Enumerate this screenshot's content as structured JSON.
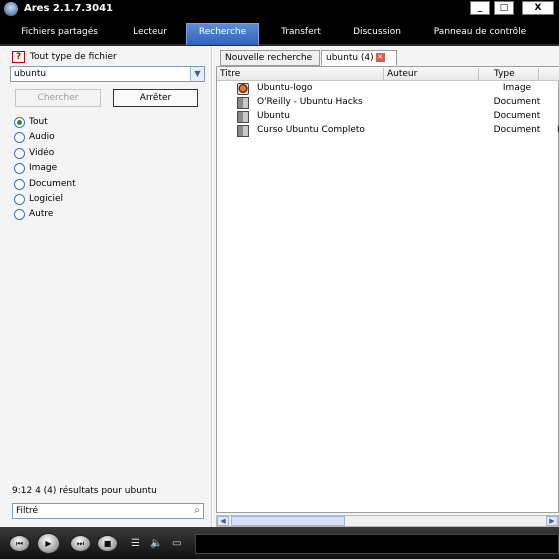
{
  "window": {
    "title": "Ares 2.1.7.3041",
    "controls": {
      "minimize": "_",
      "maximize": "□",
      "close": "X"
    }
  },
  "nav": {
    "tabs": [
      {
        "label": "Fichiers partagés",
        "active": false
      },
      {
        "label": "Lecteur",
        "active": false
      },
      {
        "label": "Recherche",
        "active": true
      },
      {
        "label": "Transfert",
        "active": false
      },
      {
        "label": "Discussion",
        "active": false
      },
      {
        "label": "Panneau de contrôle",
        "active": false
      }
    ]
  },
  "left": {
    "file_type_icon": "help-icon",
    "file_type_label": "Tout type de fichier",
    "search_value": "ubuntu",
    "search_button": "Chercher",
    "stop_button": "Arrêter",
    "radios": [
      {
        "label": "Tout",
        "checked": true
      },
      {
        "label": "Audio",
        "checked": false
      },
      {
        "label": "Vidéo",
        "checked": false
      },
      {
        "label": "Image",
        "checked": false
      },
      {
        "label": "Document",
        "checked": false
      },
      {
        "label": "Logiciel",
        "checked": false
      },
      {
        "label": "Autre",
        "checked": false
      }
    ],
    "status": "9:12   4 (4) résultats pour ubuntu",
    "filter_value": "Filtré"
  },
  "results": {
    "tabs": {
      "new_search": "Nouvelle recherche",
      "current": "ubuntu (4)"
    },
    "columns": {
      "title": "Titre",
      "author": "Auteur",
      "type": "Type"
    },
    "rows": [
      {
        "icon": "image-file-icon",
        "title": "Ubuntu-logo",
        "author": "",
        "type": "Image"
      },
      {
        "icon": "book-icon",
        "title": "O'Reilly - Ubuntu Hacks",
        "author": "",
        "type": "Document"
      },
      {
        "icon": "book-icon",
        "title": "Ubuntu",
        "author": "",
        "type": "Document"
      },
      {
        "icon": "book-icon",
        "title": "Curso Ubuntu Completo",
        "author": "",
        "type": "Document",
        "extra": "I"
      }
    ]
  },
  "player": {
    "buttons": [
      "previous",
      "play",
      "next",
      "stop"
    ],
    "icons": [
      "playlist-icon",
      "volume-icon",
      "screen-icon"
    ]
  }
}
